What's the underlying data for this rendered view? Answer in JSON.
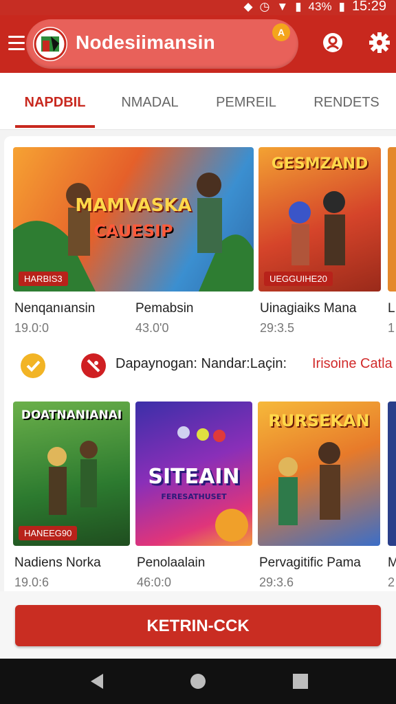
{
  "status_bar": {
    "signal": "43%",
    "time": "15:29"
  },
  "app_bar": {
    "app_name": "Nodesiimansin",
    "notification_count": "A"
  },
  "tabs": [
    "NAPDBIL",
    "NMADAL",
    "PEMREIL",
    "RENDETS"
  ],
  "games_row1": [
    {
      "title": "Nenqanıansin",
      "price": "19.0:0",
      "banner": "MAMVASKA",
      "sub": "CAUESIP",
      "tag": "HARBIS3"
    },
    {
      "title": "Pemabsin",
      "price": "43.0'0"
    },
    {
      "title": "Uinagiaiks Mana",
      "price": "29:3.5",
      "banner": "GESMZAND",
      "tag": "UEGGUIHE20"
    },
    {
      "title": "L",
      "price": "1"
    }
  ],
  "promo": {
    "text": "Dapaynogan: Nandar:Laçin:",
    "link": "Irisoine Catla"
  },
  "games_row2": [
    {
      "title": "Nadiens Norka",
      "price": "19.0:6",
      "banner": "DOATNANIANAI",
      "tag": "HANEEG90"
    },
    {
      "title": "Penolaalain",
      "price": "46:0:0",
      "banner": "SITEAIN",
      "sub": "FERESATHUSET"
    },
    {
      "title": "Pervagitific Pama",
      "price": "29:3.6",
      "banner": "RURSEKAN"
    },
    {
      "title": "M",
      "price": "2"
    }
  ],
  "cta": {
    "label": "KETRIN-CCK"
  },
  "colors": {
    "primary": "#c8281e",
    "accent": "#f2b425"
  }
}
